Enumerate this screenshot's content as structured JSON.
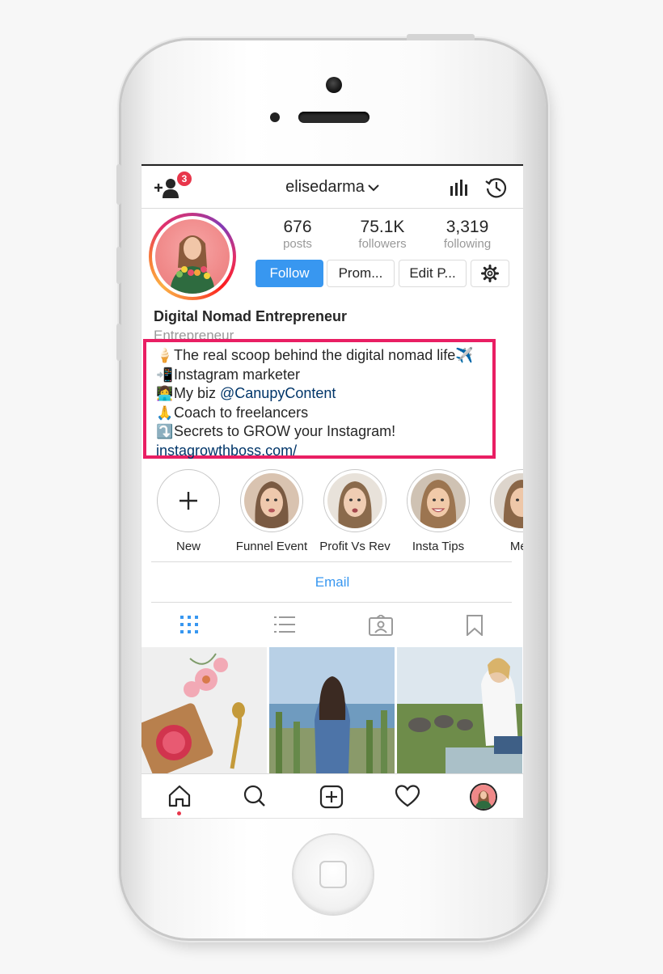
{
  "header": {
    "username": "elisedarma",
    "notification_count": "3",
    "icons": [
      "add-person-icon",
      "chevron-down-icon",
      "stats-icon",
      "history-icon"
    ]
  },
  "profile": {
    "stats": [
      {
        "value": "676",
        "label": "posts"
      },
      {
        "value": "75.1K",
        "label": "followers"
      },
      {
        "value": "3,319",
        "label": "following"
      }
    ],
    "buttons": {
      "follow": "Follow",
      "promote": "Prom...",
      "edit": "Edit P..."
    },
    "display_name": "Digital Nomad Entrepreneur",
    "category": "Entrepreneur",
    "bio": {
      "line1": {
        "emoji": "🍦",
        "text": "The real scoop behind the digital nomad life",
        "trail": "✈️"
      },
      "line2": {
        "emoji": "📲",
        "text": "Instagram marketer"
      },
      "line3": {
        "emoji": "👩‍💻",
        "prefix": "My biz ",
        "mention": "@CanupyContent"
      },
      "line4": {
        "emoji": "🙏",
        "text": "Coach to freelancers"
      },
      "line5": {
        "emoji": "⤵️",
        "text": "Secrets to GROW your Instagram!"
      },
      "link": "instagrowthboss.com/"
    }
  },
  "highlights": [
    {
      "label": "New"
    },
    {
      "label": "Funnel Event"
    },
    {
      "label": "Profit Vs Rev"
    },
    {
      "label": "Insta Tips"
    },
    {
      "label": "Mex"
    }
  ],
  "contact": {
    "email_label": "Email"
  },
  "tabs": [
    "grid-icon",
    "list-icon",
    "tagged-icon",
    "saved-icon"
  ],
  "colors": {
    "accent_blue": "#3897f0",
    "highlight_box": "#e91e63",
    "badge_red": "#e8364b",
    "link_blue": "#003569"
  },
  "bottom_nav": [
    "home-icon",
    "search-icon",
    "add-post-icon",
    "heart-icon",
    "profile-avatar-icon"
  ]
}
